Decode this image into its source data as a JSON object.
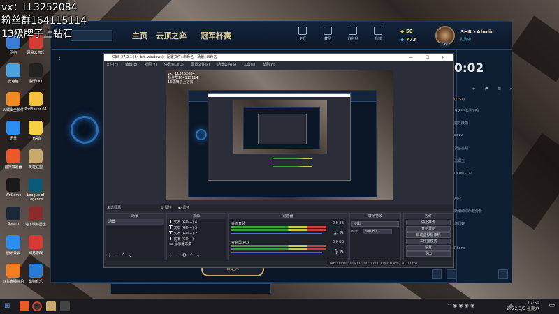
{
  "overlay": {
    "line1": "vx：LL3252084",
    "line2": "粉丝群164115114",
    "line3": "13级牌子上钻石"
  },
  "desktop_icons": [
    {
      "label": "网络",
      "color": "#3a7bd5"
    },
    {
      "label": "网易云音乐",
      "color": "#d43c33"
    },
    {
      "label": "此电脑",
      "color": "#4aa3df"
    },
    {
      "label": "腾讯QQ",
      "color": "#222"
    },
    {
      "label": "火绒安全软件",
      "color": "#f08a24"
    },
    {
      "label": "PotPlayer 64",
      "color": "#f5c242"
    },
    {
      "label": "迅雷",
      "color": "#2d8cf0"
    },
    {
      "label": "YY语音",
      "color": "#f5d142"
    },
    {
      "label": "雷神加速器",
      "color": "#e85a2a"
    },
    {
      "label": "英雄联盟",
      "color": "#c8aa6e"
    },
    {
      "label": "WeGame",
      "color": "#1a1a1a"
    },
    {
      "label": "League of Legends",
      "color": "#0a5a7a"
    },
    {
      "label": "Steam",
      "color": "#1b2838"
    },
    {
      "label": "地下城与勇士",
      "color": "#8a2a2a"
    },
    {
      "label": "腾讯会议",
      "color": "#2d8cf0"
    },
    {
      "label": "网易游戏",
      "color": "#d43c33"
    },
    {
      "label": "斗鱼直播伴侣",
      "color": "#f57c1f"
    },
    {
      "label": "酷狗音乐",
      "color": "#2a7bd5"
    }
  ],
  "client": {
    "nav_tabs": [
      "主页",
      "云顶之弈",
      "冠军杯赛"
    ],
    "nav_icons": [
      {
        "label": "生涯",
        "icon": "profile-icon"
      },
      {
        "label": "藏品",
        "icon": "collection-icon"
      },
      {
        "label": "战利品",
        "icon": "loot-icon"
      },
      {
        "label": "商城",
        "icon": "store-icon"
      }
    ],
    "rp": "50",
    "be": "773",
    "level": "139",
    "username": "SHR丶Aholic",
    "status": "队列中",
    "timer": "0:02",
    "friends_header": "(/151)",
    "friend_rows": [
      "今天不陪他了吗",
      "用妖妖捕",
      "odow",
      "茨芸芸梨",
      "沉钢玉",
      "ramerci sr",
      "",
      "用户",
      "斯纲球球乐趣分析",
      "你们好",
      "",
      "Rhone"
    ],
    "bottom_label": "自定义"
  },
  "obs": {
    "title": "OBS 27.2.1 (64-bit, windows) - 配置文件: 未命名 - 场景: 未命名",
    "menu": [
      "文件(F)",
      "编辑(E)",
      "视图(V)",
      "停靠窗口(D)",
      "配置文件(P)",
      "场景集合(S)",
      "工具(T)",
      "帮助(H)"
    ],
    "source_bar": "未选择源",
    "source_bar_props": "属性",
    "source_bar_filters": "滤镜",
    "scenes": {
      "header": "场景",
      "items": [
        "场景"
      ]
    },
    "sources": {
      "header": "来源",
      "items": [
        "文本 (GDI+) 4",
        "文本 (GDI+) 3",
        "文本 (GDI+) 2",
        "文本 (GDI+)",
        "显示器采集"
      ]
    },
    "mixer": {
      "header": "混音器",
      "channels": [
        {
          "name": "桌面音频",
          "db": "0.0 dB"
        },
        {
          "name": "麦克风/Aux",
          "db": "0.0 dB"
        }
      ]
    },
    "transitions": {
      "header": "转场特效",
      "type": "淡出",
      "duration_label": "时长",
      "duration": "300 ms"
    },
    "controls": {
      "header": "控件",
      "buttons": [
        "停止推流",
        "开始录制",
        "启动虚拟摄像机",
        "工作室模式",
        "设置",
        "退出"
      ]
    },
    "status": "LIVE: 00:00:00   REC: 00:00:00   CPU: 0.4%, 30.00 fps"
  },
  "taskbar": {
    "time": "17:59",
    "date": "2022/3/5 星期六",
    "lang": "英"
  }
}
